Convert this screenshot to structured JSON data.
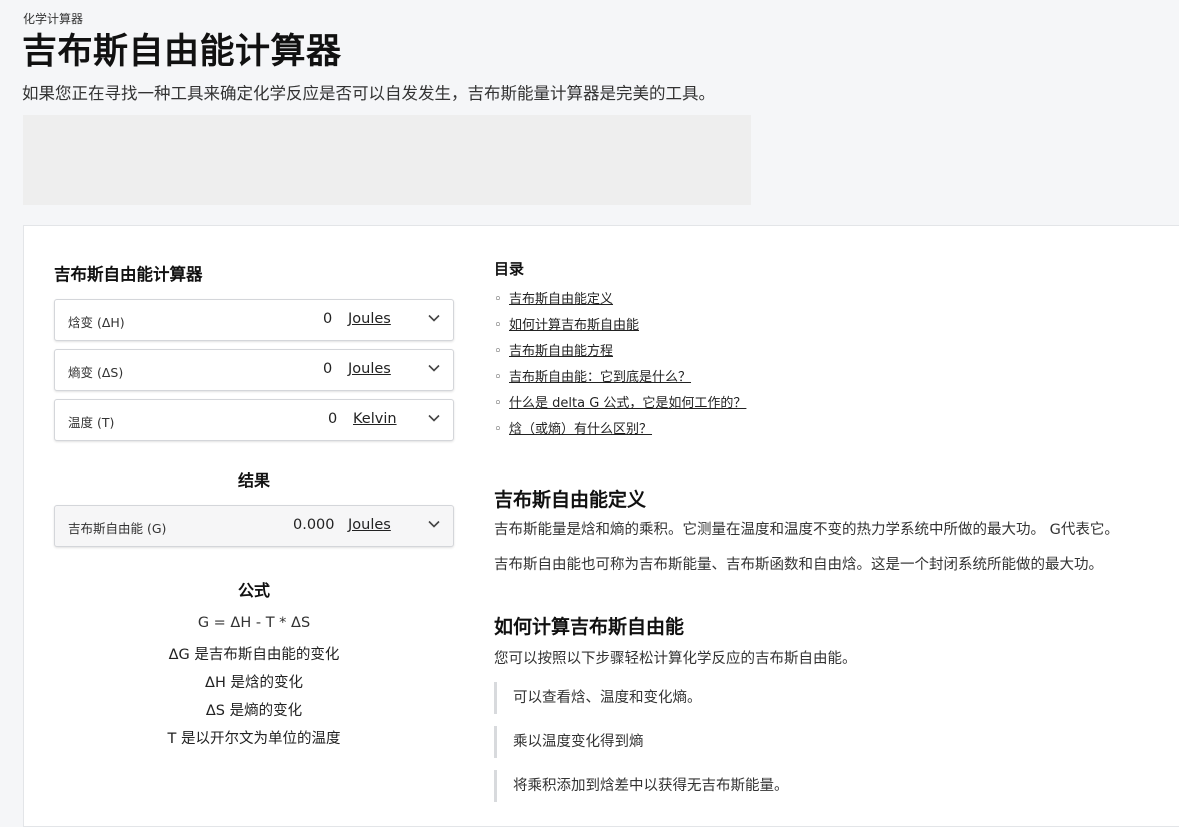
{
  "breadcrumb": "化学计算器",
  "header": {
    "title": "吉布斯自由能计算器",
    "subtitle": "如果您正在寻找一种工具来确定化学反应是否可以自发发生，吉布斯能量计算器是完美的工具。"
  },
  "calculator": {
    "title": "吉布斯自由能计算器",
    "fields": [
      {
        "label": "焓变 (ΔH)",
        "value": "0",
        "unit": "Joules"
      },
      {
        "label": "熵变 (ΔS)",
        "value": "0",
        "unit": "Joules"
      },
      {
        "label": "温度 (T)",
        "value": "0",
        "unit": "Kelvin"
      }
    ],
    "result_title": "结果",
    "result": {
      "label": "吉布斯自由能 (G)",
      "value": "0.000",
      "unit": "Joules"
    },
    "formula_title": "公式",
    "formula": "G = ΔH - T * ΔS",
    "legend": [
      "ΔG 是吉布斯自由能的变化",
      "ΔH 是焓的变化",
      "ΔS 是熵的变化",
      "T 是以开尔文为单位的温度"
    ]
  },
  "toc": {
    "title": "目录",
    "items": [
      "吉布斯自由能定义",
      "如何计算吉布斯自由能",
      "吉布斯自由能方程",
      "吉布斯自由能：它到底是什么？",
      "什么是 delta G 公式，它是如何工作的？",
      "焓（或熵）有什么区别？"
    ]
  },
  "sections": {
    "definition": {
      "title": "吉布斯自由能定义",
      "p1": "吉布斯能量是焓和熵的乘积。它测量在温度和温度不变的热力学系统中所做的最大功。 G代表它。",
      "p2": "吉布斯自由能也可称为吉布斯能量、吉布斯函数和自由焓。这是一个封闭系统所能做的最大功。"
    },
    "howto": {
      "title": "如何计算吉布斯自由能",
      "intro": "您可以按照以下步骤轻松计算化学反应的吉布斯自由能。",
      "steps": [
        "可以查看焓、温度和变化熵。",
        "乘以温度变化得到熵",
        "将乘积添加到焓差中以获得无吉布斯能量。"
      ]
    }
  }
}
